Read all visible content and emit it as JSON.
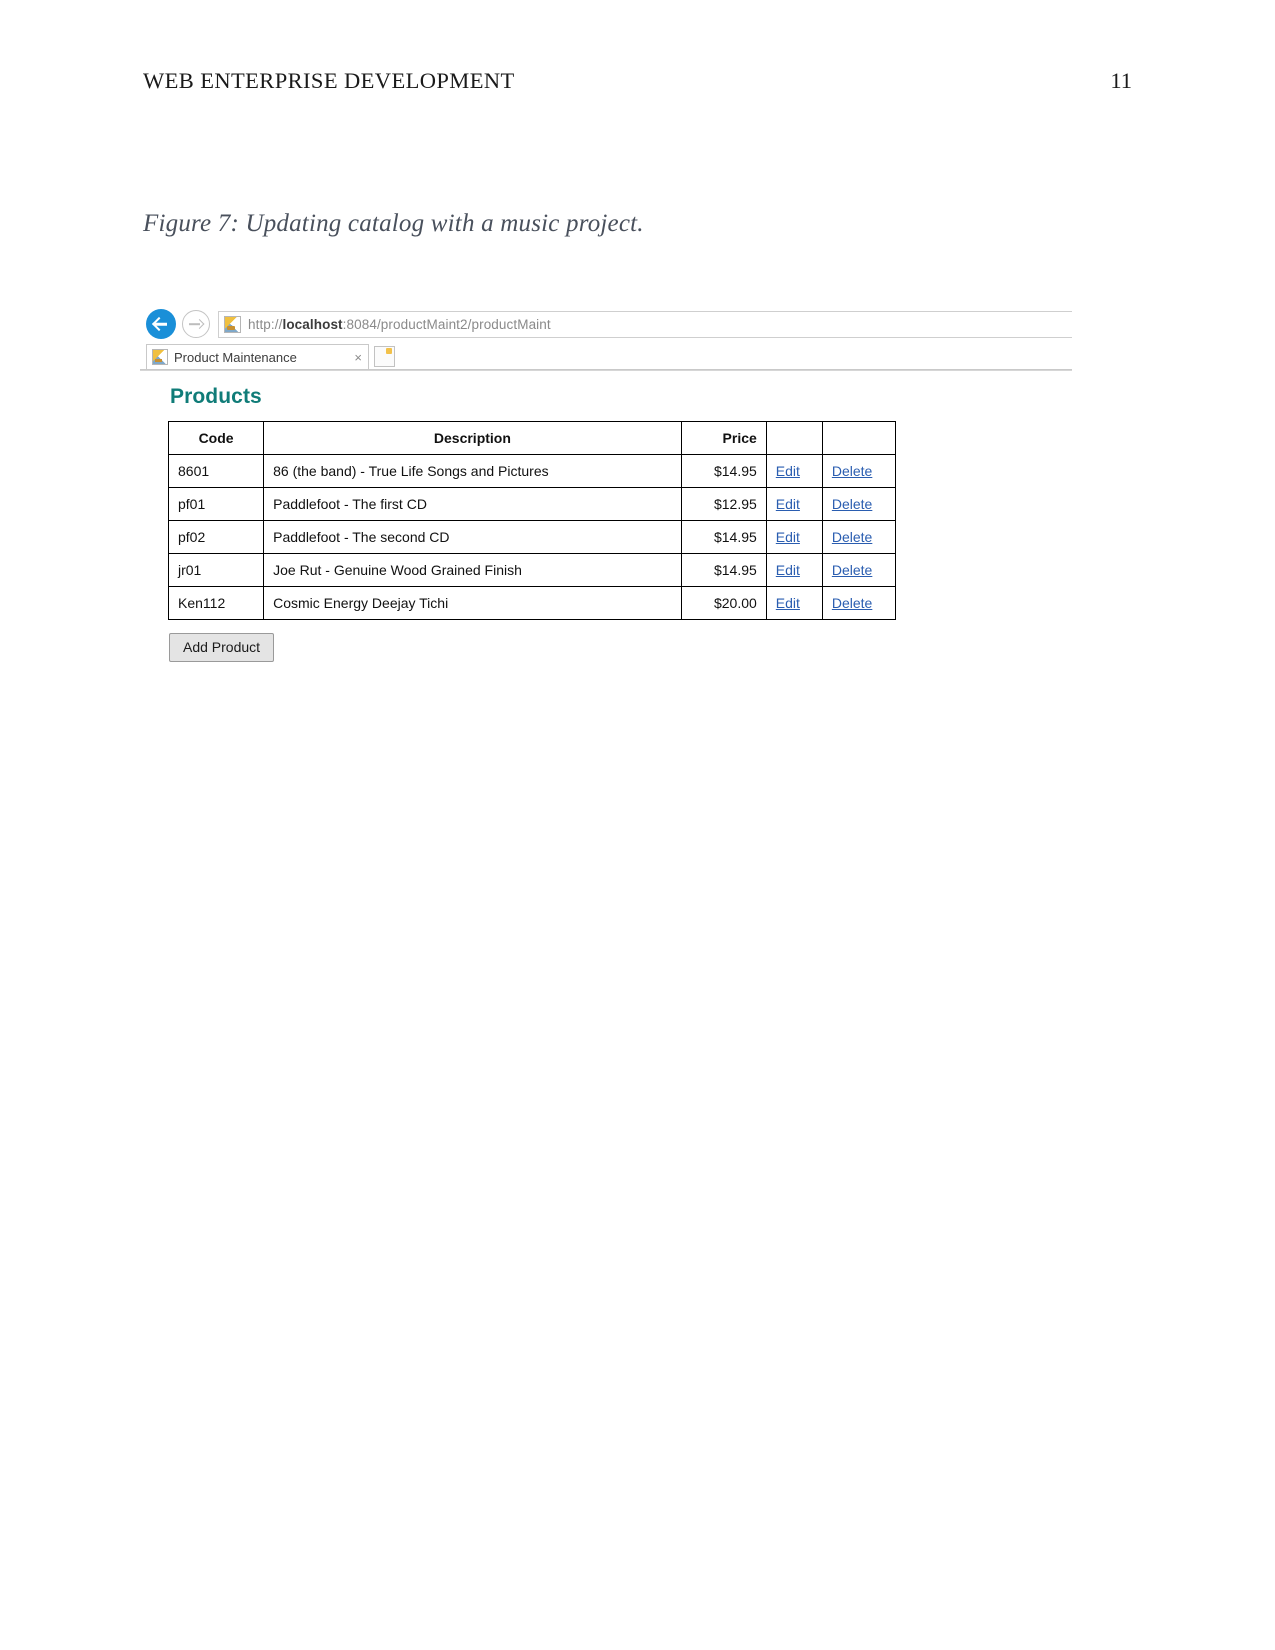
{
  "document": {
    "running_head": "WEB ENTERPRISE DEVELOPMENT",
    "page_number": "11",
    "figure_caption": "Figure 7: Updating catalog with a music project."
  },
  "browser": {
    "back_icon": "back-arrow-icon",
    "forward_icon": "forward-arrow-icon",
    "address": {
      "favicon": "site-favicon-icon",
      "url_scheme_prefix": "http://",
      "url_host": "localhost",
      "url_suffix": ":8084/productMaint2/productMaint",
      "url_full": "http://localhost:8084/productMaint2/productMaint"
    },
    "tab": {
      "favicon": "tab-favicon-icon",
      "title": "Product Maintenance",
      "close_label": "×",
      "new_tab_label": ""
    }
  },
  "page": {
    "heading": "Products",
    "table": {
      "columns": [
        "Code",
        "Description",
        "Price",
        "",
        ""
      ],
      "rows": [
        {
          "code": "8601",
          "description": "86 (the band) - True Life Songs and Pictures",
          "price": "$14.95",
          "edit": "Edit",
          "delete": "Delete"
        },
        {
          "code": "pf01",
          "description": "Paddlefoot - The first CD",
          "price": "$12.95",
          "edit": "Edit",
          "delete": "Delete"
        },
        {
          "code": "pf02",
          "description": "Paddlefoot - The second CD",
          "price": "$14.95",
          "edit": "Edit",
          "delete": "Delete"
        },
        {
          "code": "jr01",
          "description": "Joe Rut - Genuine Wood Grained Finish",
          "price": "$14.95",
          "edit": "Edit",
          "delete": "Delete"
        },
        {
          "code": "Ken112",
          "description": "Cosmic Energy Deejay Tichi",
          "price": "$20.00",
          "edit": "Edit",
          "delete": "Delete"
        }
      ]
    },
    "add_product_label": "Add Product"
  },
  "colors": {
    "heading_teal": "#107c78",
    "link_blue": "#2a5db0",
    "back_button_blue": "#1a8fd8",
    "caption_gray": "#49505c"
  }
}
